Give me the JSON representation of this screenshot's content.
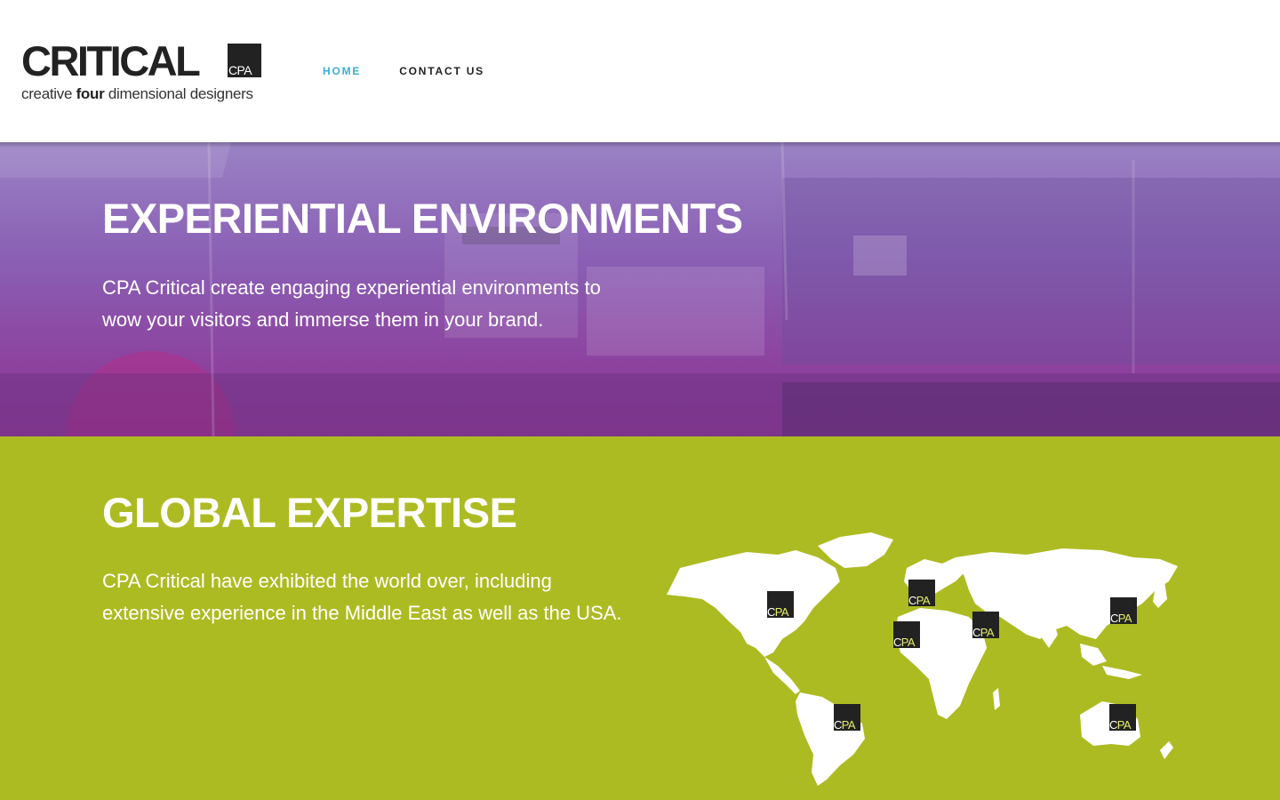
{
  "header": {
    "logo": {
      "word": "CRITICAL",
      "box_text": "CPA",
      "tagline_pre": "creative ",
      "tagline_bold": "four",
      "tagline_post": " dimensional designers"
    },
    "nav": [
      {
        "label": "HOME",
        "active": true
      },
      {
        "label": "CONTACT US",
        "active": false
      }
    ]
  },
  "hero": {
    "title": "EXPERIENTIAL ENVIRONMENTS",
    "text": "CPA Critical create engaging experiential environments to wow your visitors and immerse them in your brand."
  },
  "global": {
    "title": "GLOBAL EXPERTISE",
    "text": "CPA Critical have exhibited the world over, including extensive experience in the Middle East as well as the USA.",
    "marker_label": "CPA",
    "markers": [
      "north-america",
      "europe",
      "west-africa",
      "middle-east",
      "east-asia",
      "south-america",
      "australia"
    ]
  },
  "colors": {
    "accent_nav": "#3bb0cc",
    "hero_purple": "#8a5fb4",
    "global_green": "#adbb22",
    "logo_dark": "#222222"
  }
}
